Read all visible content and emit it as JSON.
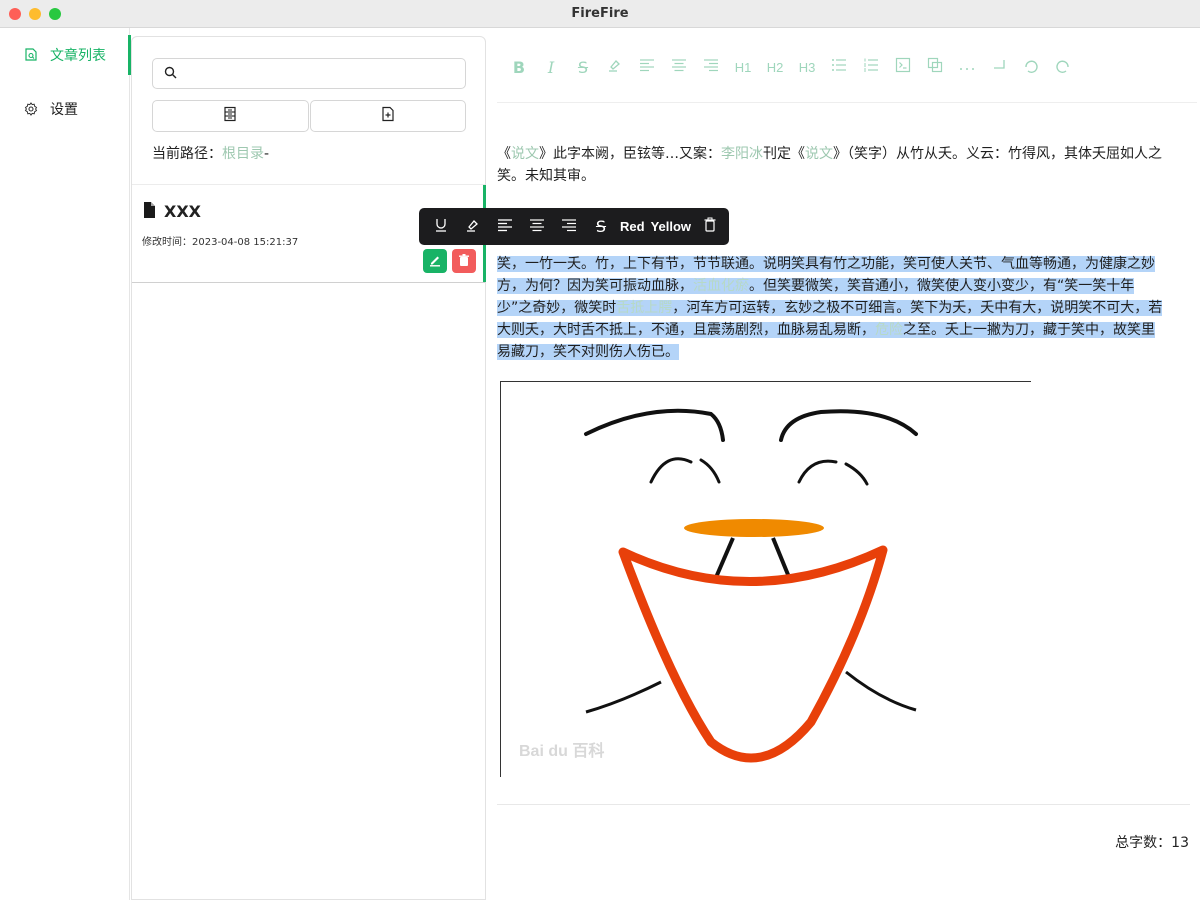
{
  "window": {
    "title": "FireFire"
  },
  "nav": {
    "items": [
      {
        "label": "文章列表",
        "icon": "document-search-icon",
        "active": true
      },
      {
        "label": "设置",
        "icon": "gear-icon",
        "active": false
      }
    ]
  },
  "list": {
    "search_placeholder": "",
    "path_label": "当前路径：",
    "path_link": "根目录",
    "path_suffix": "-",
    "articles": [
      {
        "name": "XXX",
        "mtime": "修改时间：2023-04-08 15:21:37"
      }
    ]
  },
  "editor": {
    "toolbar": [
      "bold",
      "italic",
      "strikethrough",
      "highlight",
      "align-left",
      "align-center",
      "align-right",
      "H1",
      "H2",
      "H3",
      "bullet-list",
      "ordered-list",
      "code",
      "copy",
      "more",
      "break",
      "undo",
      "redo"
    ],
    "h1": "H1",
    "h2": "H2",
    "h3": "H3",
    "para1": {
      "p1": "《",
      "l1": "说文",
      "p2": "》此字本阙，臣铉等…又案：",
      "l2": "李阳冰",
      "p3": "刊定《",
      "l3": "说文",
      "p4": "》（笑字）从竹从夭。义云：竹得风，其体夭屈如人之笑。未知其审。"
    },
    "para2": {
      "s1": "笑，一竹一夭。竹，上下有节，节节联通。说明笑具有竹之功能，笑可使人关节、气血等畅通，为健康之妙方，为何？因为笑可振动血脉，",
      "l1": "活血化瘀",
      "s2": "。但笑要微笑，笑音通小，微笑使人变小变少，有“笑一笑十年少”之奇妙，微笑时",
      "l2": "舌抵上腭",
      "s3": "，河车方可运转，玄妙之极不可细言。笑下为夭，夭中有大，说明笑不可大，若大则夭，大时舌不抵上，不通，且震荡剧烈，血脉易乱易断，",
      "l3": "危险",
      "s4": "之至。夭上一撇为刀，藏于笑中，故笑里易藏刀，笑不对则伤人伤已。"
    },
    "floatbar": {
      "red": "Red",
      "yellow": "Yellow"
    },
    "image_watermark": "Bai du 百科",
    "word_count_label": "总字数：",
    "word_count": "13"
  },
  "colors": {
    "accent": "#18b366",
    "link": "#9ec8b0",
    "selection": "#b4d4f8",
    "danger": "#f25c5c"
  }
}
